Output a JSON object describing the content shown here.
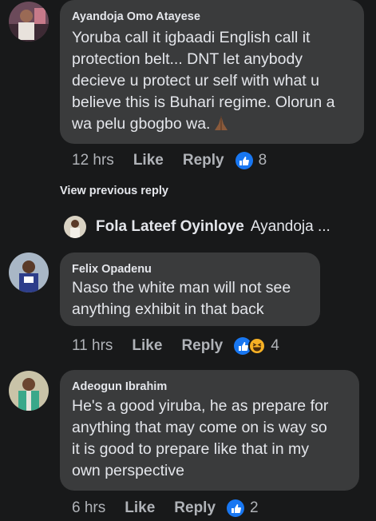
{
  "colors": {
    "background": "#18191a",
    "bubble": "#3a3b3c",
    "text": "#e4e6eb",
    "muted": "#b0b3b8",
    "like_blue": "#1877f2",
    "haha_yellow": "#f7b125"
  },
  "comments": [
    {
      "author": "Ayandoja Omo Atayese",
      "lines": [
        "Yoruba call it igbaadi English call it",
        "protection belt... DNT let anybody",
        "decieve u protect ur self with what u",
        "believe this is Buhari regime. Olorun a",
        "wa pelu gbogbo wa."
      ],
      "emoji_name": "folded-hands-icon",
      "time": "12 hrs",
      "like_label": "Like",
      "reply_label": "Reply",
      "reactions": [
        "like-icon"
      ],
      "reaction_count": "8"
    },
    {
      "author": "Felix Opadenu",
      "lines": [
        "Naso the white man will not see",
        "anything exhibit in that back"
      ],
      "time": "11 hrs",
      "like_label": "Like",
      "reply_label": "Reply",
      "reactions": [
        "like-icon",
        "haha-icon"
      ],
      "reaction_count": "4"
    },
    {
      "author": "Adeogun Ibrahim",
      "lines": [
        "He's a good yiruba, he as prepare for",
        "anything that may come on is way so",
        "it is good to prepare like that in my",
        "own perspective"
      ],
      "time": "6 hrs",
      "like_label": "Like",
      "reply_label": "Reply",
      "reactions": [
        "like-icon"
      ],
      "reaction_count": "2"
    }
  ],
  "view_previous_label": "View previous reply",
  "reply_preview": {
    "author": "Fola Lateef Oyinloye",
    "text": "Ayandoja ..."
  }
}
